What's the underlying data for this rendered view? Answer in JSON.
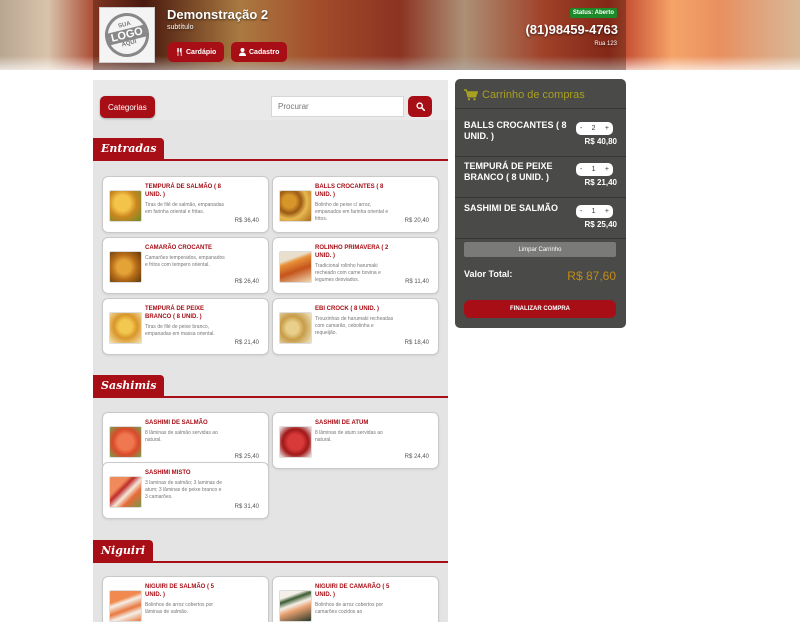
{
  "header": {
    "store_name": "Demonstração 2",
    "store_subtitle": "subtítulo",
    "logo_top": "SUA",
    "logo_main": "LOGO",
    "logo_bottom": "AQUI",
    "btn_menu": "Cardápio",
    "btn_register": "Cadastro",
    "status": "Status: Aberto",
    "phone": "(81)98459-4763",
    "address": "Rua 123"
  },
  "toolbar": {
    "categories_label": "Categorias",
    "search_placeholder": "Procurar"
  },
  "sections": [
    {
      "title": "Entradas",
      "items": [
        {
          "name": "TEMPURÁ DE SALMÃO ( 8 unid. )",
          "desc": "Tiras de filé de salmão, empanadas em farinha oriental e fritas.",
          "price": "R$ 36,40"
        },
        {
          "name": "BALLS CROCANTES ( 8 unid. )",
          "desc": "Bolinho de peixe c/ arroz, empanados em farinha oriental e fritos.",
          "price": "R$ 20,40"
        },
        {
          "name": "CAMARÃO CROCANTE",
          "desc": "Camarões temperados, empanados e fritos com tempero oriental.",
          "price": "R$ 26,40"
        },
        {
          "name": "ROLINHO PRIMAVERA ( 2 unid. )",
          "desc": "Tradicional rolinho harumaki recheado com carne bovina e legumes desviados.",
          "price": "R$ 11,40"
        },
        {
          "name": "TEMPURÁ DE PEIXE BRANCO ( 8 unid. )",
          "desc": "Tiras de filé de peixe branco, empanadas em massa oriental.",
          "price": "R$ 21,40"
        },
        {
          "name": "EBI CROCK ( 8 unid. )",
          "desc": "Trouxinhas de harumaki recheadas com camarão, cebolinha e requeijão.",
          "price": "R$ 18,40"
        }
      ]
    },
    {
      "title": "Sashimis",
      "items": [
        {
          "name": "SASHIMI DE SALMÃO",
          "desc": "8 lâminas de salmão servidas ao natural.",
          "price": "R$ 25,40"
        },
        {
          "name": "SASHIMI DE ATUM",
          "desc": "8 lâminas de atum servidas ao natural.",
          "price": "R$ 24,40"
        },
        {
          "name": "SASHIMI MISTO",
          "desc": "3 laminas de salmão; 3 laminas de atum; 3 lâminas de peixe branco e 3 camarões.",
          "price": "R$ 31,40"
        }
      ]
    },
    {
      "title": "Niguiri",
      "items": [
        {
          "name": "NIGUIRI DE SALMÃO ( 5 unid. )",
          "desc": "Bolinhos de arroz cobertos por lâminas de salmão.",
          "price": ""
        },
        {
          "name": "NIGUIRI DE CAMARÃO ( 5 unid. )",
          "desc": "Bolinhos de arroz cobertos por camarões cozidos ao",
          "price": ""
        }
      ]
    }
  ],
  "cart": {
    "title": "Carrinho de compras",
    "items": [
      {
        "name": "BALLS CROCANTES ( 8 unid. )",
        "qty": "2",
        "price": "R$ 40,80"
      },
      {
        "name": "TEMPURÁ DE PEIXE BRANCO ( 8 unid. )",
        "qty": "1",
        "price": "R$ 21,40"
      },
      {
        "name": "SASHIMI DE SALMÃO",
        "qty": "1",
        "price": "R$ 25,40"
      }
    ],
    "minus": "-",
    "plus": "+",
    "clear_label": "Limpar Carrinho",
    "total_label": "Valor Total:",
    "total_value": "R$ 87,60",
    "finish_label": "FINALIZAR COMPRA"
  },
  "colors": {
    "brand_red": "#a80e16",
    "cart_bg": "#4a4a48",
    "cart_title": "#a8a020",
    "total": "#c38b14",
    "status_green": "#1d8a2a"
  },
  "icons": [
    "cutlery-icon",
    "user-icon",
    "search-icon",
    "cart-icon"
  ]
}
